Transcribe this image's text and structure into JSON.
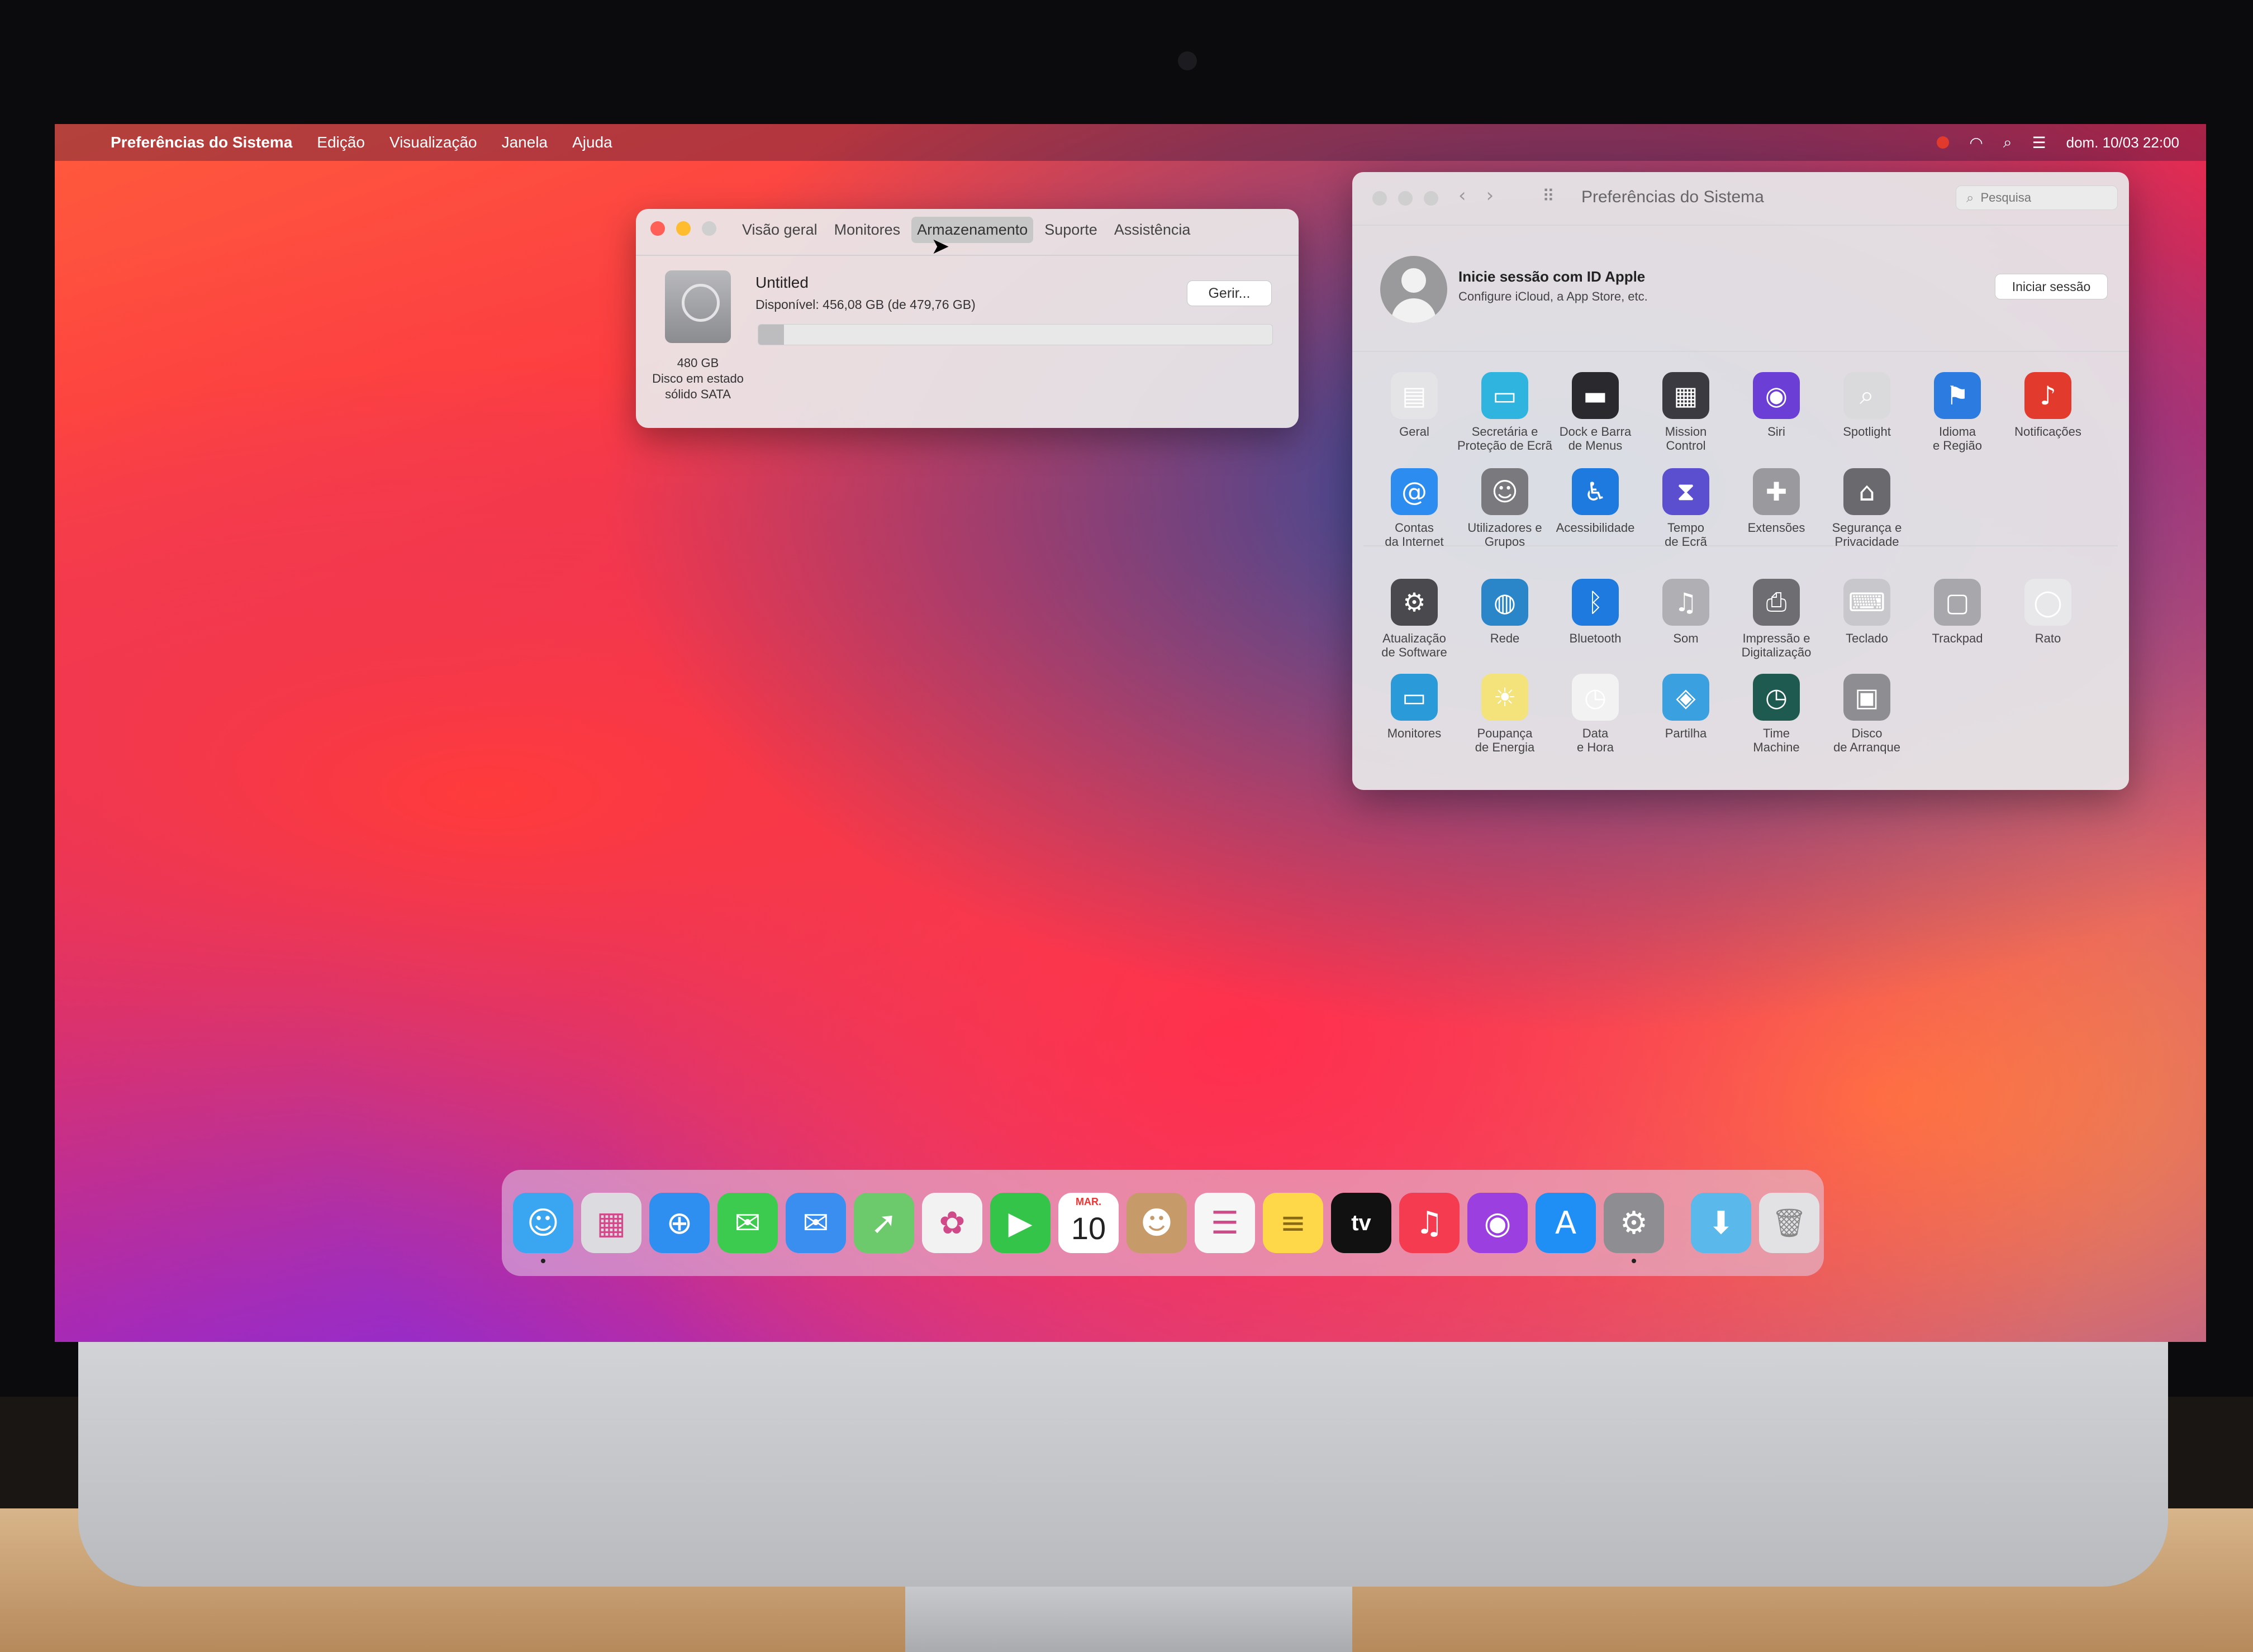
{
  "menubar": {
    "apple_glyph": "",
    "app_name": "Preferências do Sistema",
    "items": [
      "Edição",
      "Visualização",
      "Janela",
      "Ajuda"
    ],
    "clock": "dom. 10/03  22:00",
    "status_icons": [
      "recording-indicator-icon",
      "wifi-icon",
      "search-icon",
      "control-center-icon"
    ]
  },
  "about_window": {
    "tabs": [
      {
        "label": "Visão geral",
        "active": false
      },
      {
        "label": "Monitores",
        "active": false
      },
      {
        "label": "Armazenamento",
        "active": true
      },
      {
        "label": "Suporte",
        "active": false
      },
      {
        "label": "Assistência",
        "active": false
      }
    ],
    "drive": {
      "capacity": "480 GB",
      "type_line1": "Disco em estado",
      "type_line2": "sólido SATA"
    },
    "volume_name": "Untitled",
    "available": "Disponível: 456,08 GB (de 479,76 GB)",
    "used_fraction": 0.05,
    "manage_button": "Gerir..."
  },
  "prefs_window": {
    "title": "Preferências do Sistema",
    "search_placeholder": "Pesquisa",
    "appleid_title": "Inicie sessão com ID Apple",
    "appleid_subtitle": "Configure iCloud, a App Store, etc.",
    "signin_button": "Iniciar sessão",
    "panes": [
      {
        "label": "Geral",
        "icon": "general-icon",
        "color": "#e4e4e6"
      },
      {
        "label": "Secretária e\nProteção de Ecrã",
        "icon": "desktop-screensaver-icon",
        "color": "#2fb4e0"
      },
      {
        "label": "Dock e Barra\nde Menus",
        "icon": "dock-menubar-icon",
        "color": "#2a2a2e"
      },
      {
        "label": "Mission\nControl",
        "icon": "mission-control-icon",
        "color": "#3a3a40"
      },
      {
        "label": "Siri",
        "icon": "siri-icon",
        "color": "#6b3fd6"
      },
      {
        "label": "Spotlight",
        "icon": "spotlight-icon",
        "color": "#dadadc"
      },
      {
        "label": "Idioma\ne Região",
        "icon": "language-region-icon",
        "color": "#2b7be0"
      },
      {
        "label": "Notificações",
        "icon": "notifications-icon",
        "color": "#e23b2e"
      },
      {
        "label": "Contas\nda Internet",
        "icon": "internet-accounts-icon",
        "color": "#2d8cf0"
      },
      {
        "label": "Utilizadores e\nGrupos",
        "icon": "users-groups-icon",
        "color": "#7a7a7e"
      },
      {
        "label": "Acessibilidade",
        "icon": "accessibility-icon",
        "color": "#1f7ae0"
      },
      {
        "label": "Tempo\nde Ecrã",
        "icon": "screen-time-icon",
        "color": "#5b4fd0"
      },
      {
        "label": "Extensões",
        "icon": "extensions-icon",
        "color": "#9a9a9e"
      },
      {
        "label": "Segurança e\nPrivacidade",
        "icon": "security-privacy-icon",
        "color": "#6a6a6e"
      },
      {
        "label": "Atualização\nde Software",
        "icon": "software-update-icon",
        "color": "#4a4a4e"
      },
      {
        "label": "Rede",
        "icon": "network-icon",
        "color": "#2a86c8"
      },
      {
        "label": "Bluetooth",
        "icon": "bluetooth-icon",
        "color": "#1f7ae0"
      },
      {
        "label": "Som",
        "icon": "sound-icon",
        "color": "#b0b0b4"
      },
      {
        "label": "Impressão e\nDigitalização",
        "icon": "printers-scanners-icon",
        "color": "#6e6e72"
      },
      {
        "label": "Teclado",
        "icon": "keyboard-icon",
        "color": "#c8c8cc"
      },
      {
        "label": "Trackpad",
        "icon": "trackpad-icon",
        "color": "#a8a8ac"
      },
      {
        "label": "Rato",
        "icon": "mouse-icon",
        "color": "#e8e8ea"
      },
      {
        "label": "Monitores",
        "icon": "displays-icon",
        "color": "#2a9ad8"
      },
      {
        "label": "Poupança\nde Energia",
        "icon": "energy-saver-icon",
        "color": "#f4e27a"
      },
      {
        "label": "Data\ne Hora",
        "icon": "date-time-icon",
        "color": "#f2f2f2"
      },
      {
        "label": "Partilha",
        "icon": "sharing-icon",
        "color": "#3aa0e0"
      },
      {
        "label": "Time\nMachine",
        "icon": "time-machine-icon",
        "color": "#1e5a50"
      },
      {
        "label": "Disco\nde Arranque",
        "icon": "startup-disk-icon",
        "color": "#8e8e92"
      }
    ]
  },
  "dock": {
    "apps": [
      {
        "name": "finder-icon",
        "color": "#3aa5f0",
        "running": true
      },
      {
        "name": "launchpad-icon",
        "color": "#dcdce0",
        "running": false
      },
      {
        "name": "safari-icon",
        "color": "#2f8ff0",
        "running": false
      },
      {
        "name": "messages-icon",
        "color": "#3ccb4f",
        "running": false
      },
      {
        "name": "mail-icon",
        "color": "#3a8ef0",
        "running": false
      },
      {
        "name": "maps-icon",
        "color": "#6cc96c",
        "running": false
      },
      {
        "name": "photos-icon",
        "color": "#f2f2f2",
        "running": false
      },
      {
        "name": "facetime-icon",
        "color": "#34c44a",
        "running": false
      },
      {
        "name": "calendar-icon",
        "color": "#ffffff",
        "running": false
      },
      {
        "name": "contacts-icon",
        "color": "#c79a6a",
        "running": false
      },
      {
        "name": "reminders-icon",
        "color": "#f6f6f6",
        "running": false
      },
      {
        "name": "notes-icon",
        "color": "#ffd84a",
        "running": false
      },
      {
        "name": "apple-tv-icon",
        "color": "#111111",
        "running": false
      },
      {
        "name": "music-icon",
        "color": "#f43b4f",
        "running": false
      },
      {
        "name": "podcasts-icon",
        "color": "#9b3fe0",
        "running": false
      },
      {
        "name": "app-store-icon",
        "color": "#1f8ef5",
        "running": false
      },
      {
        "name": "system-preferences-icon",
        "color": "#8e8e92",
        "running": true
      }
    ],
    "calendar_month": "MAR.",
    "calendar_day": "10",
    "tv_label": "tv",
    "stack_items": [
      {
        "name": "downloads-folder-icon",
        "color": "#5ab8ea"
      },
      {
        "name": "trash-icon",
        "color": "#e2e2e4"
      }
    ]
  }
}
